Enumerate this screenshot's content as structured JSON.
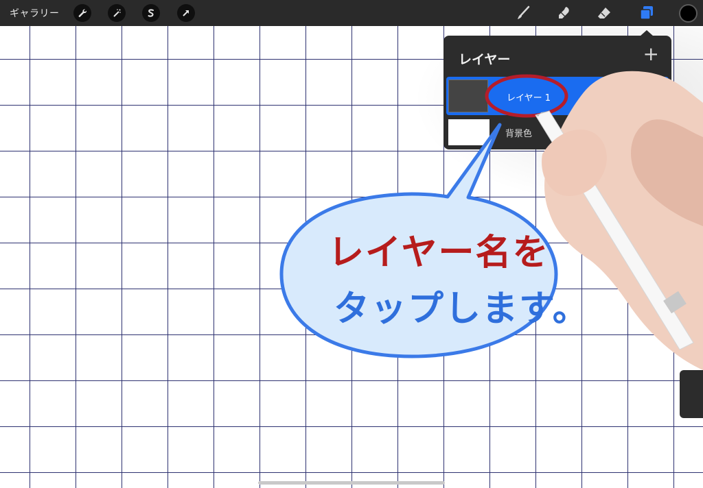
{
  "toolbar": {
    "gallery_label": "ギャラリー",
    "left_tools": [
      {
        "icon": "wrench-icon"
      },
      {
        "icon": "magic-wand-icon"
      },
      {
        "icon": "selection-icon"
      },
      {
        "icon": "transform-arrow-icon"
      }
    ],
    "right_tools": [
      {
        "icon": "brush-icon"
      },
      {
        "icon": "smudge-icon"
      },
      {
        "icon": "eraser-icon"
      },
      {
        "icon": "layers-icon",
        "active": true
      }
    ],
    "current_color": "#000000",
    "accent_color": "#2f7bf5"
  },
  "layers_panel": {
    "title": "レイヤー",
    "add_symbol": "+",
    "layers": [
      {
        "name": "レイヤー 1",
        "selected": true,
        "visible": true
      },
      {
        "name": "背景色",
        "selected": false,
        "visible": true
      }
    ]
  },
  "annotation": {
    "line1": "レイヤー名を",
    "line2": "タップします。",
    "line1_color": "#b61c1c",
    "line2_color": "#2f6fdc",
    "bubble_fill": "#d8eafc",
    "bubble_stroke": "#3b7ae8",
    "highlight_stroke": "#b51d2a"
  }
}
